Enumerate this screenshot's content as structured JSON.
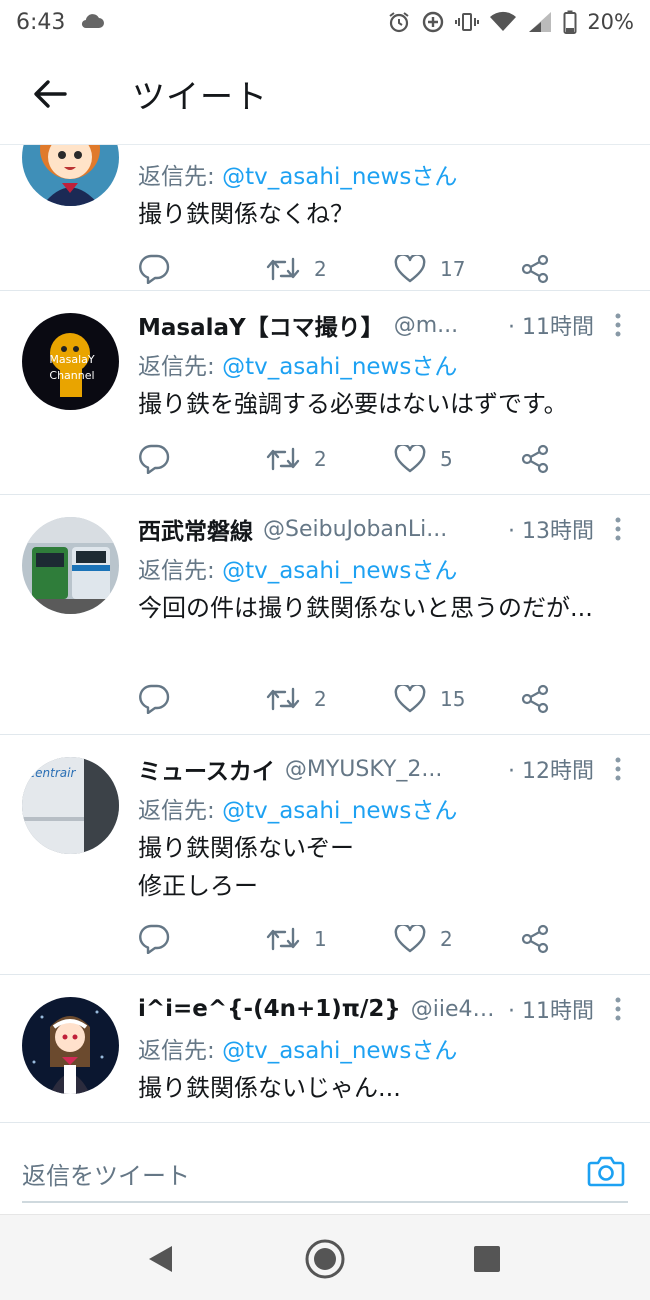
{
  "status_bar": {
    "time": "6:43",
    "battery": "20%"
  },
  "header": {
    "title": "ツイート"
  },
  "tweets": [
    {
      "name": "",
      "handle": "",
      "time": "",
      "reply_prefix": "返信先: ",
      "reply_to": "@tv_asahi_newsさん",
      "text": "撮り鉄関係なくね？",
      "retweets": "2",
      "likes": "17"
    },
    {
      "name": "MasalaY【コマ撮り】",
      "handle": "@m...",
      "time": "· 11時間",
      "reply_prefix": "返信先: ",
      "reply_to": "@tv_asahi_newsさん",
      "text": "撮り鉄を強調する必要はないはずです。",
      "retweets": "2",
      "likes": "5",
      "avatar_text": "MasalaY Channel"
    },
    {
      "name": "西武常磐線",
      "handle": "@SeibuJobanLi...",
      "time": "· 13時間",
      "reply_prefix": "返信先: ",
      "reply_to": "@tv_asahi_newsさん",
      "text": "今回の件は撮り鉄関係ないと思うのだが...",
      "retweets": "2",
      "likes": "15"
    },
    {
      "name": "ミュースカイ",
      "handle": "@MYUSKY_2...",
      "time": "· 12時間",
      "reply_prefix": "返信先: ",
      "reply_to": "@tv_asahi_newsさん",
      "text": "撮り鉄関係ないぞー\n修正しろー",
      "retweets": "1",
      "likes": "2",
      "avatar_text": "centrair"
    },
    {
      "name": "i^i=e^{-(4n+1)π/2}",
      "handle": "@iie4n...",
      "time": "· 11時間",
      "reply_prefix": "返信先: ",
      "reply_to": "@tv_asahi_newsさん",
      "text": "撮り鉄関係ないじゃん...",
      "retweets": "",
      "likes": ""
    }
  ],
  "reply_bar": {
    "placeholder": "返信をツイート"
  },
  "colors": {
    "accent": "#1da1f2",
    "secondary_text": "#657786",
    "primary_text": "#14171a",
    "divider": "#e1e8ed"
  },
  "icons": [
    "cloud-icon",
    "alarm-icon",
    "data-saver-icon",
    "vibrate-icon",
    "wifi-icon",
    "signal-icon",
    "battery-icon",
    "back-arrow-icon",
    "more-vertical-icon",
    "reply-icon",
    "retweet-icon",
    "like-icon",
    "share-icon",
    "camera-icon",
    "nav-back-icon",
    "nav-home-icon",
    "nav-recents-icon"
  ]
}
